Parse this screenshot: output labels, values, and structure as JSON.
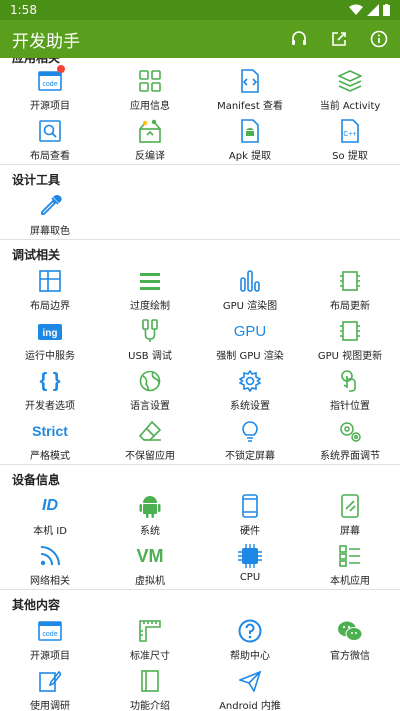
{
  "status_bar": {
    "time": "1:58"
  },
  "app_bar": {
    "title": "开发助手"
  },
  "partial_section": {
    "title": "应用相关"
  },
  "sections": [
    {
      "title": "",
      "items": [
        {
          "label": "开源项目",
          "icon": "code-icon",
          "badge": true
        },
        {
          "label": "应用信息",
          "icon": "grid-icon"
        },
        {
          "label": "Manifest 查看",
          "icon": "apk-file-icon"
        },
        {
          "label": "当前 Activity",
          "icon": "layers-icon"
        },
        {
          "label": "布局查看",
          "icon": "layout-search-icon"
        },
        {
          "label": "反编译",
          "icon": "decompile-icon"
        },
        {
          "label": "Apk 提取",
          "icon": "apk-extract-icon"
        },
        {
          "label": "So 提取",
          "icon": "so-file-icon"
        }
      ]
    },
    {
      "title": "设计工具",
      "items": [
        {
          "label": "屏幕取色",
          "icon": "eyedropper-icon"
        }
      ]
    },
    {
      "title": "调试相关",
      "items": [
        {
          "label": "布局边界",
          "icon": "layout-bounds-icon"
        },
        {
          "label": "过度绘制",
          "icon": "overdraw-icon"
        },
        {
          "label": "GPU 渲染图",
          "icon": "gpu-bars-icon"
        },
        {
          "label": "布局更新",
          "icon": "layout-update-icon"
        },
        {
          "label": "运行中服务",
          "icon": "running-services-icon"
        },
        {
          "label": "USB 调试",
          "icon": "usb-icon"
        },
        {
          "label": "强制 GPU 渲染",
          "icon": "gpu-text-icon"
        },
        {
          "label": "GPU 视图更新",
          "icon": "gpu-view-icon"
        },
        {
          "label": "开发者选项",
          "icon": "braces-icon"
        },
        {
          "label": "语言设置",
          "icon": "globe-icon"
        },
        {
          "label": "系统设置",
          "icon": "settings-icon"
        },
        {
          "label": "指针位置",
          "icon": "pointer-icon"
        },
        {
          "label": "严格模式",
          "icon": "strict-icon"
        },
        {
          "label": "不保留应用",
          "icon": "eraser-icon"
        },
        {
          "label": "不锁定屏幕",
          "icon": "bulb-icon"
        },
        {
          "label": "系统界面调节",
          "icon": "gears-icon"
        }
      ]
    },
    {
      "title": "设备信息",
      "items": [
        {
          "label": "本机 ID",
          "icon": "id-icon"
        },
        {
          "label": "系统",
          "icon": "android-icon"
        },
        {
          "label": "硬件",
          "icon": "phone-icon"
        },
        {
          "label": "屏幕",
          "icon": "screen-icon"
        },
        {
          "label": "网络相关",
          "icon": "rss-icon"
        },
        {
          "label": "虚拟机",
          "icon": "vm-icon"
        },
        {
          "label": "CPU",
          "icon": "cpu-icon"
        },
        {
          "label": "本机应用",
          "icon": "app-list-icon"
        }
      ]
    },
    {
      "title": "其他内容",
      "items": [
        {
          "label": "开源项目",
          "icon": "code-icon"
        },
        {
          "label": "标准尺寸",
          "icon": "ruler-icon"
        },
        {
          "label": "帮助中心",
          "icon": "help-icon"
        },
        {
          "label": "官方微信",
          "icon": "wechat-icon"
        },
        {
          "label": "使用调研",
          "icon": "survey-icon"
        },
        {
          "label": "功能介绍",
          "icon": "book-icon"
        },
        {
          "label": "Android 内推",
          "icon": "send-icon"
        }
      ]
    }
  ],
  "colors": {
    "primary": "#5a9e1e",
    "status": "#4a8f16",
    "blue": "#1e88e5",
    "green": "#4caf50"
  }
}
